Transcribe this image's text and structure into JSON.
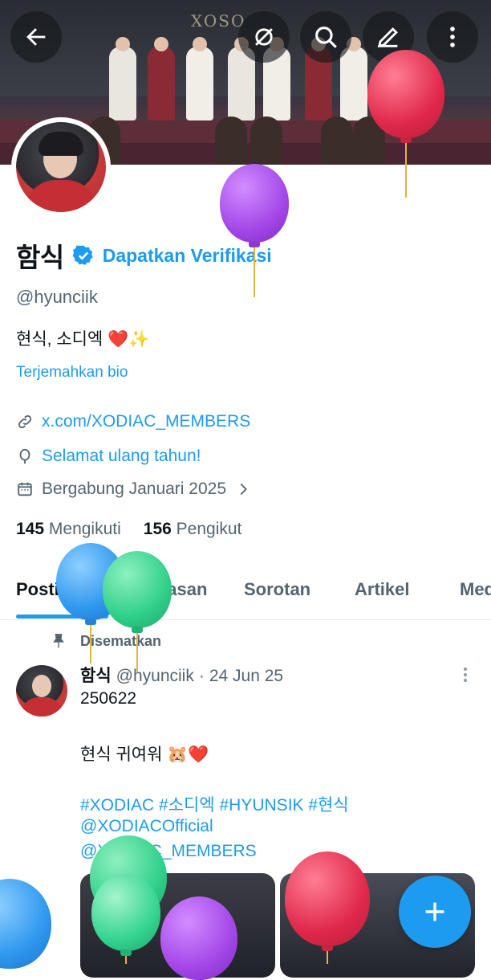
{
  "header": {
    "back_icon": "back-arrow-icon",
    "actions": [
      "mute-icon",
      "search-icon",
      "edit-icon",
      "more-vertical-icon"
    ],
    "banner_text": "XOSO"
  },
  "profile": {
    "name": "함식",
    "get_verified": "Dapatkan Verifikasi",
    "handle": "@hyunciik",
    "bio": "현식, 소디엑 ❤️✨",
    "translate_bio": "Terjemahkan bio",
    "website": "x.com/XODIAC_MEMBERS",
    "birthday": "Selamat ulang tahun!",
    "joined": "Bergabung Januari 2025",
    "following_count": "145",
    "following_label": "Mengikuti",
    "followers_count": "156",
    "followers_label": "Pengikut"
  },
  "tabs": [
    "Postingan",
    "Balasan",
    "Sorotan",
    "Artikel",
    "Media"
  ],
  "post": {
    "pinned_label": "Disematkan",
    "name": "함식",
    "handle": "@hyunciik",
    "dot": "·",
    "date": "24 Jun 25",
    "line1": "250622",
    "line2": "현식 귀여워 🐹❤️",
    "hashtags": "#XODIAC #소디엑 #HYUNSIK #현식",
    "mention1": "@XODIACOfficial",
    "mention2": "@XODIAC_MEMBERS"
  },
  "fab": {
    "icon": "plus-icon"
  },
  "colors": {
    "accent": "#1d9bf0",
    "text": "#0f1419",
    "secondary": "#536471"
  }
}
